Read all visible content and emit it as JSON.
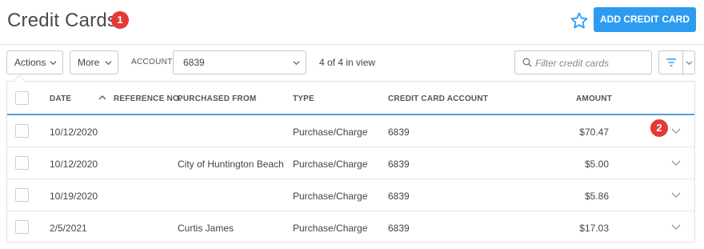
{
  "header": {
    "title": "Credit Cards",
    "callout_1": "1",
    "add_button": "ADD CREDIT CARD",
    "favorite_icon": "star-icon",
    "accent_color": "#2d9cf0",
    "callout_color": "#e53935"
  },
  "toolbar": {
    "actions_label": "Actions",
    "more_label": "More",
    "account_label": "ACCOUNT",
    "account_value": "6839",
    "count_text": "4 of 4 in view",
    "search_placeholder": "Filter credit cards",
    "search_icon": "search-icon",
    "filter_icon": "filter-icon"
  },
  "table": {
    "columns": {
      "date": "DATE",
      "reference": "REFERENCE NO.",
      "purchased_from": "PURCHASED FROM",
      "type": "TYPE",
      "account": "CREDIT CARD ACCOUNT",
      "amount": "AMOUNT"
    },
    "sort": {
      "column": "date",
      "direction": "ascending"
    },
    "rows": [
      {
        "date": "10/12/2020",
        "reference": "",
        "purchased_from": "",
        "type": "Purchase/Charge",
        "account": "6839",
        "amount": "$70.47"
      },
      {
        "date": "10/12/2020",
        "reference": "",
        "purchased_from": "City of Huntington Beach",
        "type": "Purchase/Charge",
        "account": "6839",
        "amount": "$5.00"
      },
      {
        "date": "10/19/2020",
        "reference": "",
        "purchased_from": "",
        "type": "Purchase/Charge",
        "account": "6839",
        "amount": "$5.86"
      },
      {
        "date": "2/5/2021",
        "reference": "",
        "purchased_from": "Curtis James",
        "type": "Purchase/Charge",
        "account": "6839",
        "amount": "$17.03"
      }
    ],
    "callout_2": "2"
  }
}
